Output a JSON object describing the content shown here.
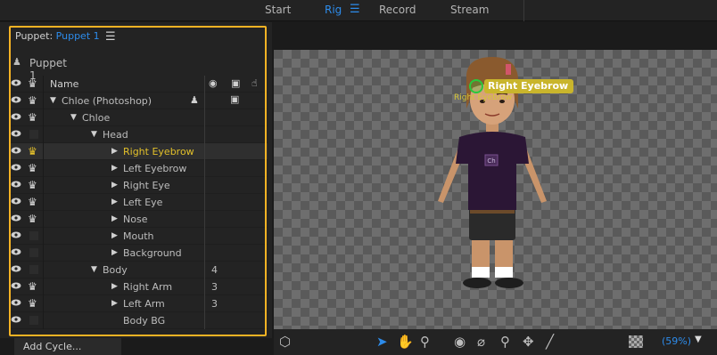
{
  "top_tabs": [
    {
      "label": "Start",
      "active": false
    },
    {
      "label": "Rig",
      "active": true
    },
    {
      "label": "Record",
      "active": false
    },
    {
      "label": "Stream",
      "active": false
    }
  ],
  "puppet_panel": {
    "title_prefix": "Puppet:",
    "puppet_name": "Puppet 1",
    "puppet_title": "Puppet 1",
    "header_name": "Name",
    "accent_color": "#2d8ceb",
    "highlight_color": "#f5b324"
  },
  "layers": [
    {
      "name": "Chloe (Photoshop)",
      "depth": 0,
      "expanded": true,
      "eye": true,
      "crown": "white",
      "puppet_icon": true,
      "camera_icon": true,
      "count": ""
    },
    {
      "name": "Chloe",
      "depth": 1,
      "expanded": true,
      "eye": true,
      "crown": "white",
      "count": ""
    },
    {
      "name": "Head",
      "depth": 2,
      "expanded": true,
      "eye": true,
      "crown": "none",
      "count": ""
    },
    {
      "name": "Right Eyebrow",
      "depth": 3,
      "expanded": false,
      "eye": true,
      "crown": "yellow",
      "selected": true,
      "count": ""
    },
    {
      "name": "Left Eyebrow",
      "depth": 3,
      "expanded": false,
      "eye": true,
      "crown": "white",
      "count": ""
    },
    {
      "name": "Right Eye",
      "depth": 3,
      "expanded": false,
      "eye": true,
      "crown": "white",
      "count": ""
    },
    {
      "name": "Left Eye",
      "depth": 3,
      "expanded": false,
      "eye": true,
      "crown": "white",
      "count": ""
    },
    {
      "name": "Nose",
      "depth": 3,
      "expanded": false,
      "eye": true,
      "crown": "white",
      "count": ""
    },
    {
      "name": "Mouth",
      "depth": 3,
      "expanded": false,
      "eye": true,
      "crown": "none",
      "count": ""
    },
    {
      "name": "Background",
      "depth": 3,
      "expanded": false,
      "eye": true,
      "crown": "none",
      "count": ""
    },
    {
      "name": "Body",
      "depth": 2,
      "expanded": true,
      "eye": true,
      "crown": "none",
      "count": "4"
    },
    {
      "name": "Right Arm",
      "depth": 3,
      "expanded": false,
      "eye": true,
      "crown": "white",
      "count": "3"
    },
    {
      "name": "Left Arm",
      "depth": 3,
      "expanded": false,
      "eye": true,
      "crown": "white",
      "count": "3"
    },
    {
      "name": "Body BG",
      "depth": 3,
      "leaf": true,
      "eye": true,
      "crown": "none",
      "count": ""
    }
  ],
  "add_cycle_label": "Add Cycle...",
  "stage": {
    "tooltip": "Right Eyebrow",
    "handle_label": "Right Eyebrow",
    "shirt_logo": "Ch"
  },
  "toolbar": {
    "zoom_label": "(59%)",
    "tools": [
      "puppet-warp-icon",
      "select-arrow-icon",
      "hand-icon",
      "zoom-icon",
      "origin-icon",
      "dragger-icon",
      "pin-icon",
      "move-handle-icon",
      "stick-icon",
      "checkerboard-icon"
    ]
  }
}
